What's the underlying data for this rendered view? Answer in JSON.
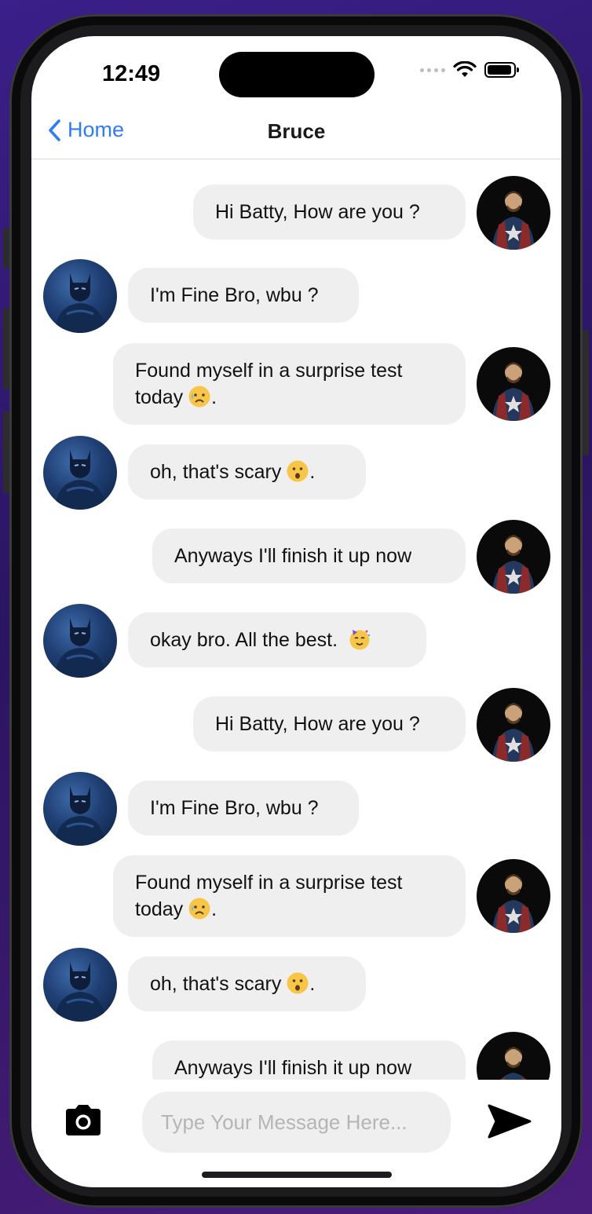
{
  "status": {
    "time": "12:49"
  },
  "nav": {
    "back_label": "Home",
    "title": "Bruce"
  },
  "messages": [
    {
      "sender": "me",
      "text": "Hi Batty, How are you ?"
    },
    {
      "sender": "them",
      "text": "I'm Fine Bro, wbu ?"
    },
    {
      "sender": "me",
      "text": "Found myself in a surprise test today",
      "emoji": "sad-sweat-emoji",
      "suffix": "."
    },
    {
      "sender": "them",
      "text": "oh, that's scary",
      "emoji": "hushed-emoji",
      "suffix": "."
    },
    {
      "sender": "me",
      "text": "Anyways I'll finish it up now"
    },
    {
      "sender": "them",
      "text": "okay bro. All the best.",
      "emoji": "party-emoji"
    },
    {
      "sender": "me",
      "text": "Hi Batty, How are you ?"
    },
    {
      "sender": "them",
      "text": "I'm Fine Bro, wbu ?"
    },
    {
      "sender": "me",
      "text": "Found myself in a surprise test today",
      "emoji": "sad-sweat-emoji",
      "suffix": "."
    },
    {
      "sender": "them",
      "text": "oh, that's scary",
      "emoji": "hushed-emoji",
      "suffix": "."
    },
    {
      "sender": "me",
      "text": "Anyways I'll finish it up now"
    }
  ],
  "composer": {
    "placeholder": "Type Your Message Here..."
  },
  "colors": {
    "accent": "#2f7cf6",
    "bubble": "#efefef"
  }
}
